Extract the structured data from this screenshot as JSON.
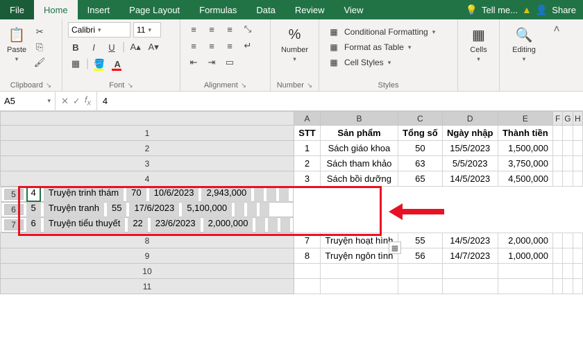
{
  "tabs": {
    "file": "File",
    "home": "Home",
    "insert": "Insert",
    "pagelayout": "Page Layout",
    "formulas": "Formulas",
    "data": "Data",
    "review": "Review",
    "view": "View",
    "tellme": "Tell me...",
    "share": "Share"
  },
  "ribbon": {
    "clipboard": {
      "paste": "Paste",
      "label": "Clipboard"
    },
    "font": {
      "name": "Calibri",
      "size": "11",
      "label": "Font"
    },
    "alignment": {
      "label": "Alignment"
    },
    "number": {
      "btn": "Number",
      "label": "Number"
    },
    "styles": {
      "cond": "Conditional Formatting",
      "table": "Format as Table",
      "cell": "Cell Styles",
      "label": "Styles"
    },
    "cells": {
      "btn": "Cells"
    },
    "editing": {
      "btn": "Editing"
    }
  },
  "fbar": {
    "namebox": "A5",
    "formula": "4"
  },
  "cols": [
    "A",
    "B",
    "C",
    "D",
    "E",
    "F",
    "G",
    "H"
  ],
  "rows": [
    "1",
    "2",
    "3",
    "4",
    "5",
    "6",
    "7",
    "8",
    "9",
    "10",
    "11"
  ],
  "headers": {
    "stt": "STT",
    "sp": "Sản phẩm",
    "ts": "Tổng số",
    "nn": "Ngày nhập",
    "tt": "Thành tiền"
  },
  "r2": {
    "a": "1",
    "b": "Sách giáo khoa",
    "c": "50",
    "d": "15/5/2023",
    "e": "1,500,000"
  },
  "r3": {
    "a": "2",
    "b": "Sách tham khảo",
    "c": "63",
    "d": "5/5/2023",
    "e": "3,750,000"
  },
  "r4": {
    "a": "3",
    "b": "Sách bồi dưỡng",
    "c": "65",
    "d": "14/5/2023",
    "e": "4,500,000"
  },
  "r5": {
    "a": "4",
    "b": "Truyện trinh thám",
    "c": "70",
    "d": "10/6/2023",
    "e": "2,943,000"
  },
  "r6": {
    "a": "5",
    "b": "Truyện tranh",
    "c": "55",
    "d": "17/6/2023",
    "e": "5,100,000"
  },
  "r7": {
    "a": "6",
    "b": "Truyện tiểu thuyết",
    "c": "22",
    "d": "23/6/2023",
    "e": "2,000,000"
  },
  "r8": {
    "a": "7",
    "b": "Truyện hoạt hình",
    "c": "55",
    "d": "14/5/2023",
    "e": "2,000,000"
  },
  "r9": {
    "a": "8",
    "b": "Truyện ngôn tình",
    "c": "56",
    "d": "14/7/2023",
    "e": "1,000,000"
  }
}
